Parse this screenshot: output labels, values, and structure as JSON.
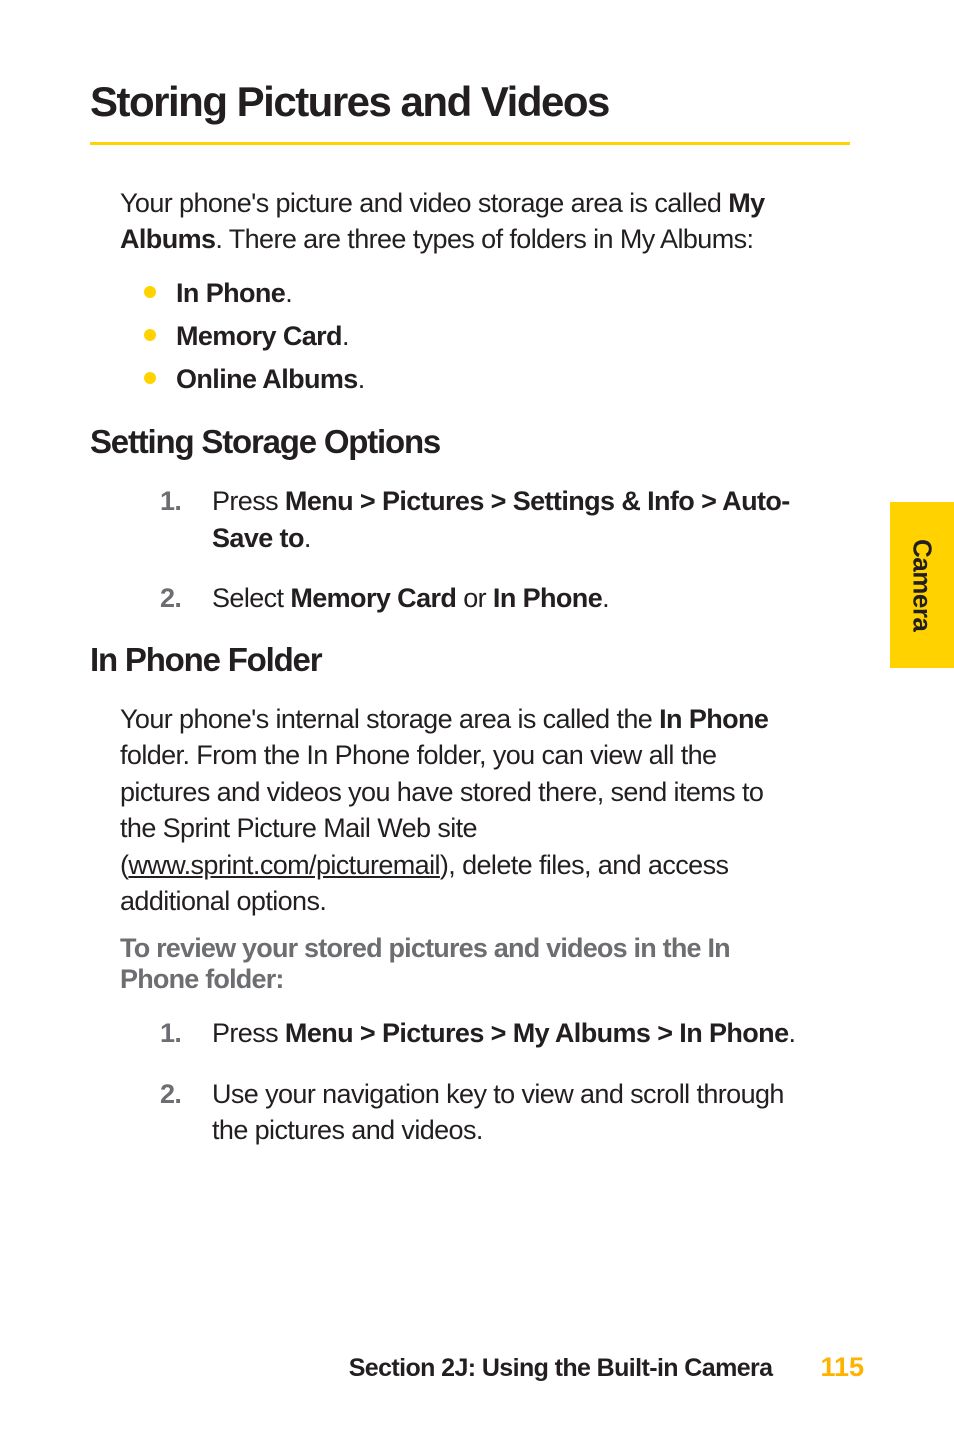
{
  "sidebar": {
    "tab_label": "Camera"
  },
  "title": "Storing Pictures and Videos",
  "intro": {
    "pre": "Your phone's picture and video storage area is called ",
    "bold": "My Albums",
    "post": ". There are three types of folders in My Albums:"
  },
  "bullets": [
    {
      "text": "In Phone",
      "suffix": "."
    },
    {
      "text": " Memory Card",
      "suffix": "."
    },
    {
      "text": "Online Albums",
      "suffix": "."
    }
  ],
  "section1": {
    "heading": "Setting Storage Options",
    "steps": [
      {
        "num": "1.",
        "pre": "Press ",
        "bold": "Menu > Pictures > Settings & Info > Auto-Save to",
        "post": "."
      },
      {
        "num": "2.",
        "pre": "Select ",
        "bold1": "Memory Card",
        "mid": " or ",
        "bold2": "In Phone",
        "post": "."
      }
    ]
  },
  "section2": {
    "heading": "In Phone Folder",
    "para": {
      "t1": "Your phone's internal storage area is called the ",
      "b1": "In Phone",
      "t2": " folder. From the In Phone folder, you can view all the pictures and videos you have stored there,  send items to the Sprint Picture Mail Web site (",
      "link": "www.sprint.com/picturemail",
      "t3": "), delete files, and access additional options."
    },
    "lead": "To review your stored pictures and videos in the In Phone folder:",
    "steps": [
      {
        "num": "1.",
        "pre": "Press ",
        "bold": "Menu > Pictures > My Albums > In Phone",
        "post": "."
      },
      {
        "num": "2.",
        "text": "Use your navigation key to view and scroll through the pictures and videos."
      }
    ]
  },
  "footer": {
    "section": "Section 2J: Using the Built-in Camera",
    "page": "115"
  }
}
